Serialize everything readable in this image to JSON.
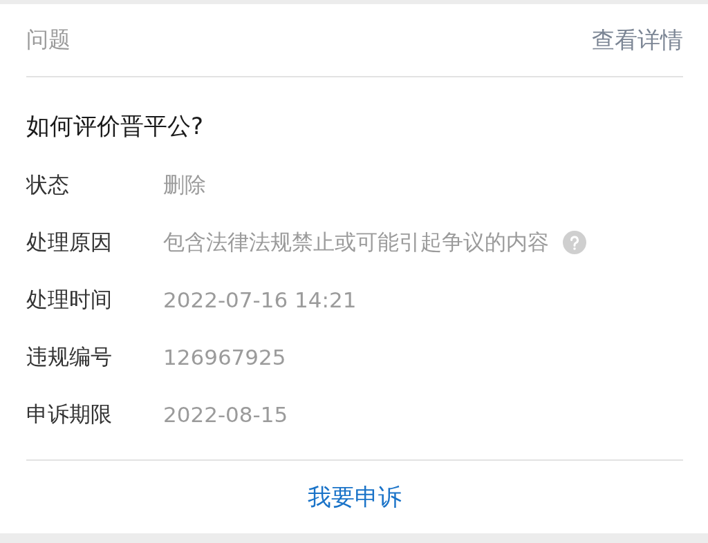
{
  "header": {
    "title": "问题",
    "link": "查看详情"
  },
  "question": "如何评价晋平公?",
  "fields": [
    {
      "label": "状态",
      "value": "删除"
    },
    {
      "label": "处理原因",
      "value": "包含法律法规禁止或可能引起争议的内容",
      "help": true
    },
    {
      "label": "处理时间",
      "value": "2022-07-16 14:21"
    },
    {
      "label": "违规编号",
      "value": "126967925"
    },
    {
      "label": "申诉期限",
      "value": "2022-08-15"
    }
  ],
  "action": "我要申诉"
}
